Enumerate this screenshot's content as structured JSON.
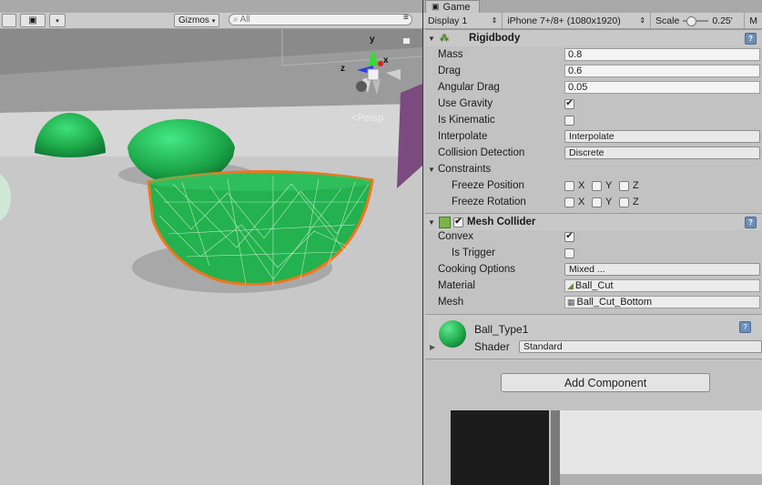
{
  "scene": {
    "toolbar": {
      "gizmos_label": "Gizmos",
      "search_placeholder": "All"
    },
    "persp_label": "Persp",
    "axes": {
      "x": "x",
      "y": "y",
      "z": "z"
    }
  },
  "game": {
    "tab_label": "Game",
    "display": "Display 1",
    "resolution": "iPhone 7+/8+ (1080x1920)",
    "scale_label": "Scale",
    "scale_value": "0.25'",
    "maximize_truncated": "M"
  },
  "rigidbody": {
    "title": "Rigidbody",
    "mass_label": "Mass",
    "mass": "0.8",
    "drag_label": "Drag",
    "drag": "0.6",
    "angular_drag_label": "Angular Drag",
    "angular_drag": "0.05",
    "use_gravity_label": "Use Gravity",
    "use_gravity": true,
    "is_kinematic_label": "Is Kinematic",
    "is_kinematic": false,
    "interpolate_label": "Interpolate",
    "interpolate": "Interpolate",
    "collision_label": "Collision Detection",
    "collision": "Discrete",
    "constraints_label": "Constraints",
    "freeze_position_label": "Freeze Position",
    "freeze_rotation_label": "Freeze Rotation",
    "axis_x": "X",
    "axis_y": "Y",
    "axis_z": "Z"
  },
  "mesh_collider": {
    "title": "Mesh Collider",
    "enabled": true,
    "convex_label": "Convex",
    "convex": true,
    "is_trigger_label": "Is Trigger",
    "is_trigger": false,
    "cooking_label": "Cooking Options",
    "cooking": "Mixed ...",
    "material_label": "Material",
    "material": "Ball_Cut",
    "mesh_label": "Mesh",
    "mesh": "Ball_Cut_Bottom"
  },
  "material": {
    "name": "Ball_Type1",
    "shader_label": "Shader",
    "shader": "Standard"
  },
  "add_component_label": "Add Component",
  "colors": {
    "ball_green": "#1faa4a",
    "selection_orange": "#f0761c",
    "inspector_bg": "#c2c2c2"
  }
}
